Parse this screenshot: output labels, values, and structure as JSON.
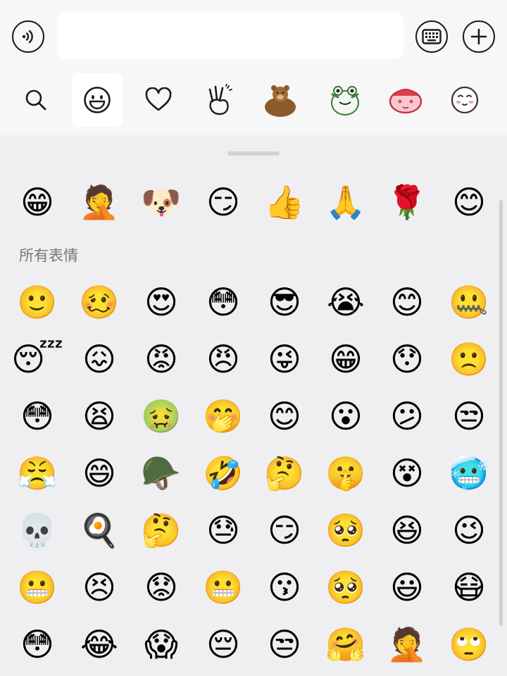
{
  "input_bar": {
    "voice_icon": "voice-icon",
    "text_value": "",
    "keyboard_icon": "keyboard-icon",
    "add_icon": "plus-icon"
  },
  "tabs": [
    {
      "icon": "search-icon",
      "active": false
    },
    {
      "icon": "smiley-icon",
      "active": true
    },
    {
      "icon": "heart-icon",
      "active": false
    },
    {
      "icon": "victory-hand-icon",
      "active": false
    },
    {
      "icon": "bear-sticker-icon",
      "active": false
    },
    {
      "icon": "frog-sticker-icon",
      "active": false
    },
    {
      "icon": "pink-sticker-icon",
      "active": false
    },
    {
      "icon": "blush-face-icon",
      "active": false
    }
  ],
  "recent": [
    "😁",
    "🤦",
    "🐶",
    "😏",
    "👍",
    "🙏",
    "🌹",
    "😊"
  ],
  "section_title": "所有表情",
  "all_emojis": [
    [
      "🙂",
      "🥴",
      "😍",
      "😳",
      "😎",
      "😭",
      "😊",
      "🤐"
    ],
    [
      "😴",
      "😖",
      "😡",
      "😠",
      "😜",
      "😁",
      "😯",
      "🙁"
    ],
    [
      "😳",
      "😫",
      "🤢",
      "🤭",
      "😊",
      "😮",
      "😕",
      "😒"
    ],
    [
      "😤",
      "😄",
      "🪖",
      "🤣",
      "🤔",
      "🤫",
      "😵",
      "🥶"
    ],
    [
      "💀",
      "🍳",
      "🤔",
      "😓",
      "😏",
      "🥺",
      "😆",
      "😉"
    ],
    [
      "😬",
      "😣",
      "😟",
      "😬",
      "😗",
      "🥺",
      "😃",
      "😷"
    ],
    [
      "😳",
      "😂",
      "😱",
      "😔",
      "😒",
      "🤗",
      "🤦",
      "🙄"
    ]
  ],
  "colors": {
    "accent": "#1b1b1b",
    "panel_bg": "#efeff1",
    "bar_bg": "#f7f7f8",
    "active_tab": "#ffffff"
  }
}
